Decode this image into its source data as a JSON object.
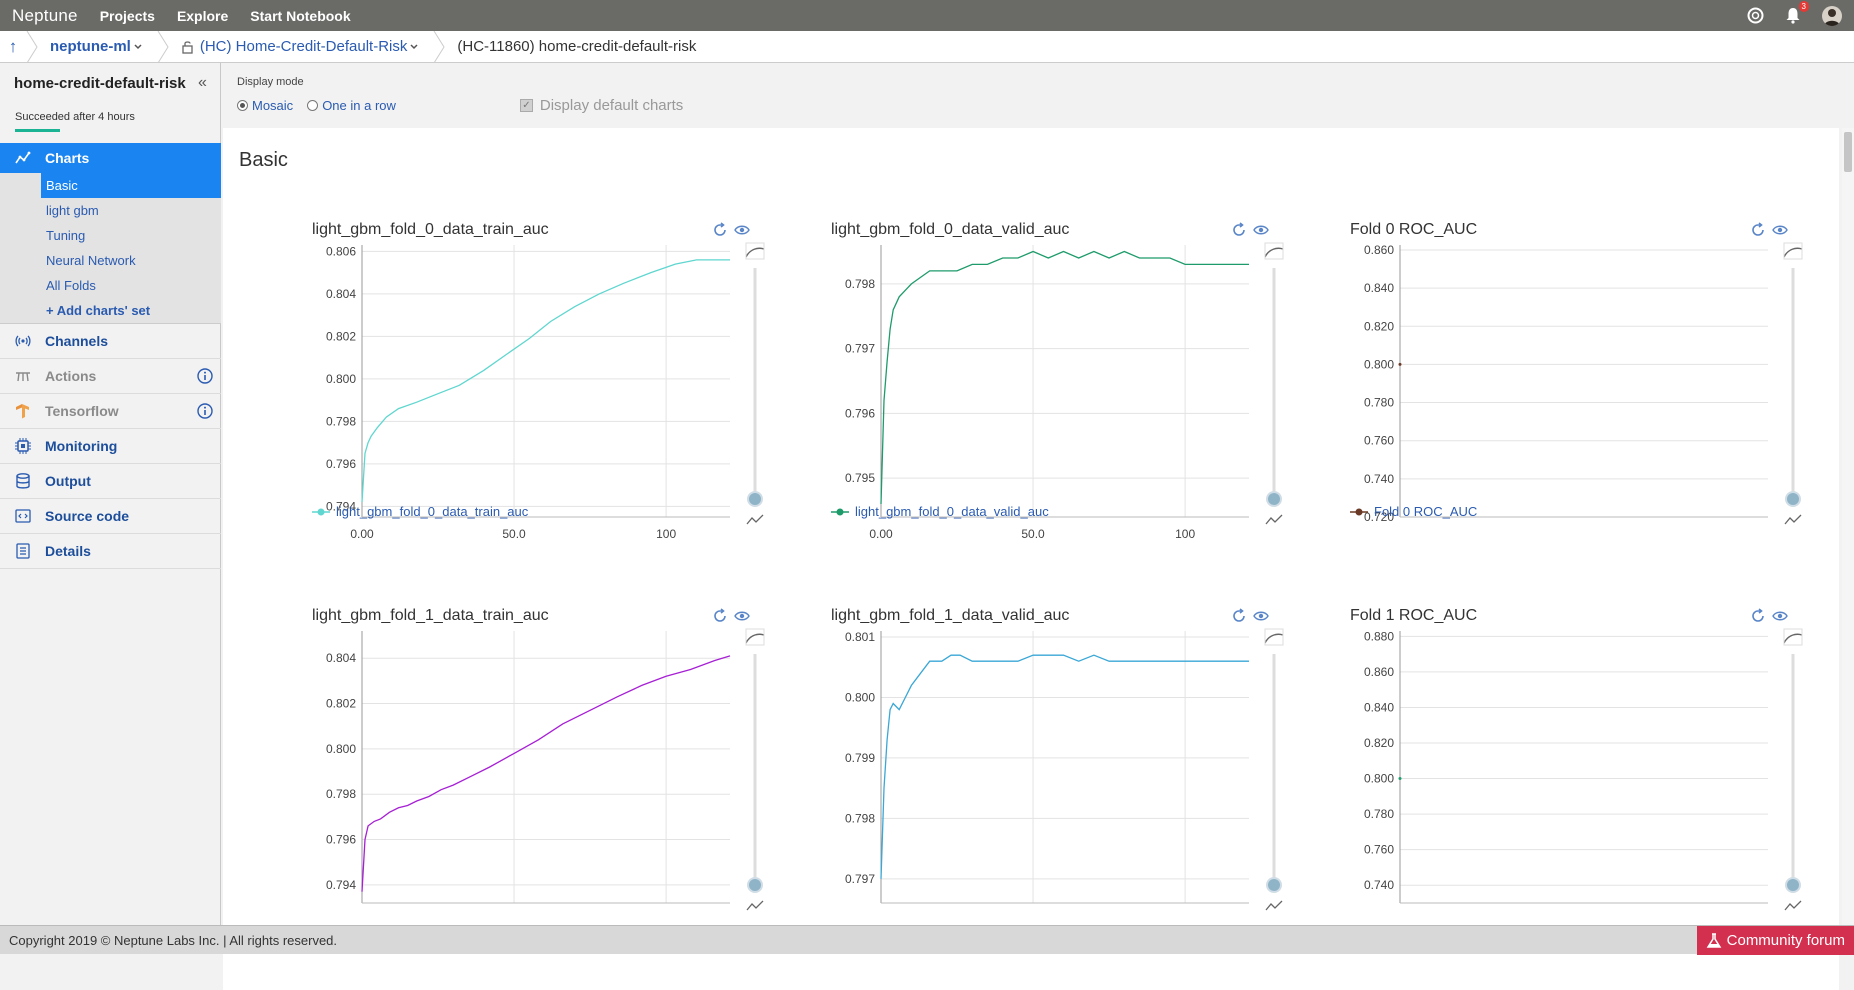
{
  "topbar": {
    "logo": "Neptune",
    "nav": [
      "Projects",
      "Explore",
      "Start Notebook"
    ],
    "notification_count": "3"
  },
  "breadcrumb": {
    "project": "neptune-ml",
    "group": "(HC) Home-Credit-Default-Risk",
    "experiment": "(HC-11860) home-credit-default-risk"
  },
  "sidebar": {
    "experiment_name": "home-credit-default-risk",
    "status": "Succeeded after 4 hours",
    "items": [
      {
        "label": "Charts",
        "icon": "charts-icon",
        "active": true
      },
      {
        "label": "Channels",
        "icon": "channels-icon"
      },
      {
        "label": "Actions",
        "icon": "actions-icon",
        "disabled": true
      },
      {
        "label": "Tensorflow",
        "icon": "tensorflow-icon",
        "disabled": true
      },
      {
        "label": "Monitoring",
        "icon": "monitoring-icon"
      },
      {
        "label": "Output",
        "icon": "output-icon"
      },
      {
        "label": "Source code",
        "icon": "source-code-icon"
      },
      {
        "label": "Details",
        "icon": "details-icon"
      }
    ],
    "chart_sets": [
      "Basic",
      "light gbm",
      "Tuning",
      "Neural Network",
      "All Folds",
      "+ Add charts' set"
    ]
  },
  "display_mode": {
    "label": "Display mode",
    "options": [
      "Mosaic",
      "One in a row"
    ],
    "selected": "Mosaic",
    "default_charts_label": "Display default charts"
  },
  "section_title": "Basic",
  "chart_data": [
    {
      "type": "line",
      "title": "light_gbm_fold_0_data_train_auc",
      "legend": "light_gbm_fold_0_data_train_auc",
      "color": "#5fd6cf",
      "x_ticks": [
        "0.00",
        "50.0",
        "100"
      ],
      "y_ticks": [
        "0.794",
        "0.796",
        "0.798",
        "0.800",
        "0.802",
        "0.804",
        "0.806"
      ],
      "xlim": [
        0,
        121
      ],
      "ylim": [
        0.7935,
        0.8063
      ],
      "x": [
        0,
        1,
        2,
        3,
        5,
        8,
        12,
        18,
        25,
        32,
        40,
        47,
        55,
        62,
        70,
        78,
        86,
        95,
        103,
        110,
        121
      ],
      "y": [
        0.7942,
        0.7965,
        0.797,
        0.7973,
        0.7977,
        0.7982,
        0.7986,
        0.7989,
        0.7993,
        0.7997,
        0.8004,
        0.8011,
        0.8019,
        0.8027,
        0.8034,
        0.804,
        0.8045,
        0.805,
        0.8054,
        0.8056,
        0.8056
      ]
    },
    {
      "type": "line",
      "title": "light_gbm_fold_0_data_valid_auc",
      "legend": "light_gbm_fold_0_data_valid_auc",
      "color": "#1e9b6b",
      "x_ticks": [
        "0.00",
        "50.0",
        "100"
      ],
      "y_ticks": [
        "0.795",
        "0.796",
        "0.797",
        "0.798"
      ],
      "xlim": [
        0,
        121
      ],
      "ylim": [
        0.7944,
        0.7986
      ],
      "x": [
        0,
        1,
        2,
        3,
        4,
        6,
        8,
        10,
        13,
        16,
        20,
        25,
        30,
        35,
        40,
        45,
        50,
        55,
        60,
        65,
        70,
        75,
        80,
        85,
        90,
        95,
        100,
        105,
        110,
        115,
        121
      ],
      "y": [
        0.7946,
        0.7962,
        0.7968,
        0.7973,
        0.7976,
        0.7978,
        0.7979,
        0.798,
        0.7981,
        0.7982,
        0.7982,
        0.7982,
        0.7983,
        0.7983,
        0.7984,
        0.7984,
        0.7985,
        0.7984,
        0.7985,
        0.7984,
        0.7985,
        0.7984,
        0.7985,
        0.7984,
        0.7984,
        0.7984,
        0.7983,
        0.7983,
        0.7983,
        0.7983,
        0.7983
      ]
    },
    {
      "type": "line",
      "title": "Fold 0 ROC_AUC",
      "legend": "Fold 0 ROC_AUC",
      "color": "#6b3a26",
      "y_ticks": [
        "0.720",
        "0.740",
        "0.760",
        "0.780",
        "0.800",
        "0.820",
        "0.840",
        "0.860"
      ],
      "ylim": [
        0.72,
        0.8626
      ],
      "x": [
        0
      ],
      "y": [
        0.8
      ]
    },
    {
      "type": "line",
      "title": "light_gbm_fold_1_data_train_auc",
      "color": "#a61fd4",
      "y_ticks": [
        "0.794",
        "0.796",
        "0.798",
        "0.800",
        "0.802",
        "0.804"
      ],
      "xlim": [
        0,
        121
      ],
      "ylim": [
        0.7932,
        0.8052
      ],
      "x": [
        0,
        1,
        2,
        4,
        6,
        9,
        12,
        15,
        18,
        22,
        26,
        30,
        36,
        42,
        50,
        58,
        66,
        75,
        84,
        92,
        100,
        108,
        116,
        121
      ],
      "y": [
        0.7937,
        0.796,
        0.7966,
        0.7968,
        0.7969,
        0.7972,
        0.7974,
        0.7975,
        0.7977,
        0.7979,
        0.7982,
        0.7984,
        0.7988,
        0.7992,
        0.7998,
        0.8004,
        0.8011,
        0.8017,
        0.8023,
        0.8028,
        0.8032,
        0.8035,
        0.8039,
        0.8041
      ]
    },
    {
      "type": "line",
      "title": "light_gbm_fold_1_data_valid_auc",
      "color": "#3aa7d6",
      "y_ticks": [
        "0.797",
        "0.798",
        "0.799",
        "0.800",
        "0.801"
      ],
      "xlim": [
        0,
        121
      ],
      "ylim": [
        0.7966,
        0.8011
      ],
      "x": [
        0,
        1,
        2,
        3,
        4,
        6,
        8,
        10,
        13,
        16,
        20,
        23,
        26,
        30,
        35,
        40,
        45,
        50,
        55,
        60,
        65,
        70,
        75,
        80,
        85,
        90,
        95,
        100,
        105,
        110,
        115,
        121
      ],
      "y": [
        0.797,
        0.7985,
        0.7993,
        0.7998,
        0.7999,
        0.7998,
        0.8,
        0.8002,
        0.8004,
        0.8006,
        0.8006,
        0.8007,
        0.8007,
        0.8006,
        0.8006,
        0.8006,
        0.8006,
        0.8007,
        0.8007,
        0.8007,
        0.8006,
        0.8007,
        0.8006,
        0.8006,
        0.8006,
        0.8006,
        0.8006,
        0.8006,
        0.8006,
        0.8006,
        0.8006,
        0.8006
      ]
    },
    {
      "type": "line",
      "title": "Fold 1 ROC_AUC",
      "color": "#1e9b6b",
      "y_ticks": [
        "0.740",
        "0.760",
        "0.780",
        "0.800",
        "0.820",
        "0.840",
        "0.860",
        "0.880"
      ],
      "ylim": [
        0.73,
        0.883
      ],
      "x": [
        0
      ],
      "y": [
        0.8
      ]
    }
  ],
  "footer": {
    "copyright": "Copyright 2019 © Neptune Labs Inc. | All rights reserved.",
    "community": "Community forum"
  }
}
